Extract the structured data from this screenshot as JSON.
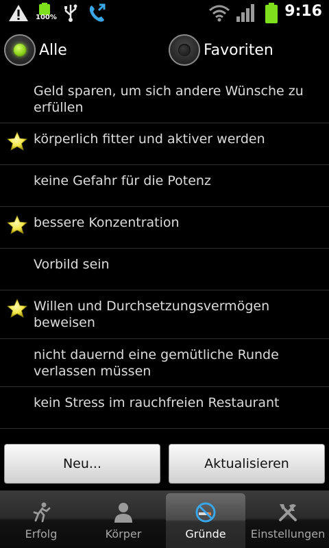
{
  "status_bar": {
    "battery_percent": "100%",
    "time": "9:16",
    "icons": [
      "warning-icon",
      "battery-notify-icon",
      "usb-icon",
      "call-forward-icon",
      "wifi-icon",
      "signal-icon",
      "battery-icon"
    ]
  },
  "filter": {
    "options": [
      {
        "label": "Alle",
        "selected": true
      },
      {
        "label": "Favoriten",
        "selected": false
      }
    ]
  },
  "reasons": [
    {
      "text": "Geld sparen, um sich andere Wünsche zu erfüllen",
      "favorite": false
    },
    {
      "text": "körperlich fitter und aktiver werden",
      "favorite": true
    },
    {
      "text": "keine Gefahr für die Potenz",
      "favorite": false
    },
    {
      "text": "bessere Konzentration",
      "favorite": true
    },
    {
      "text": "Vorbild sein",
      "favorite": false
    },
    {
      "text": "Willen und Durchsetzungsvermögen beweisen",
      "favorite": true
    },
    {
      "text": "nicht dauernd eine gemütliche Runde verlassen müssen",
      "favorite": false
    },
    {
      "text": "kein Stress im rauchfreien Restaurant",
      "favorite": false
    }
  ],
  "buttons": {
    "new_label": "Neu...",
    "refresh_label": "Aktualisieren"
  },
  "tabs": [
    {
      "label": "Erfolg",
      "icon": "runner-icon",
      "selected": false
    },
    {
      "label": "Körper",
      "icon": "person-icon",
      "selected": false
    },
    {
      "label": "Gründe",
      "icon": "no-smoking-icon",
      "selected": true
    },
    {
      "label": "Einstellungen",
      "icon": "tools-icon",
      "selected": false
    }
  ],
  "colors": {
    "background": "#000000",
    "radio_checked": "#8fd31c",
    "star": "#f2e64a",
    "divider": "#2e2e2e"
  }
}
